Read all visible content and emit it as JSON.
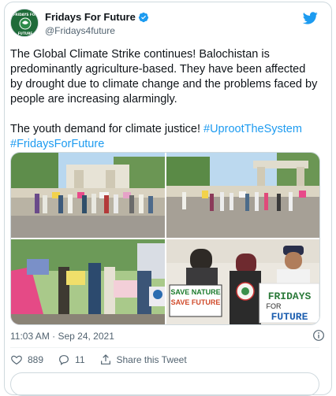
{
  "tweet": {
    "author_name": "Fridays For Future",
    "author_handle": "@Fridays4future",
    "avatar_text": "FRIDAYS FOR FUTURE",
    "paragraph1": "The Global Climate Strike continues! Balochistan is predominantly agriculture-based. They have been affected by drought due to climate change and the problems faced by people are increasing alarmingly.",
    "paragraph2_text": "The youth demand for climate justice! ",
    "hashtag1": "#UprootTheSystem",
    "hashtag2": "#FridaysForFuture",
    "timestamp": "11:03 AM · Sep 24, 2021"
  },
  "photos": {
    "sign_save_nature": "SAVE NATURE SAVE FUTURE",
    "sign_fridays": "FRIDAYS FOR FUTURE"
  },
  "actions": {
    "like_count": "889",
    "reply_count": "11",
    "share_label": "Share this Tweet"
  },
  "colors": {
    "link": "#1d9bf0",
    "text": "#0f1419",
    "secondary": "#536471",
    "border": "#cfd9de"
  },
  "icons": [
    "verified-badge-icon",
    "twitter-bird-icon",
    "info-icon",
    "heart-icon",
    "reply-icon",
    "share-icon"
  ]
}
